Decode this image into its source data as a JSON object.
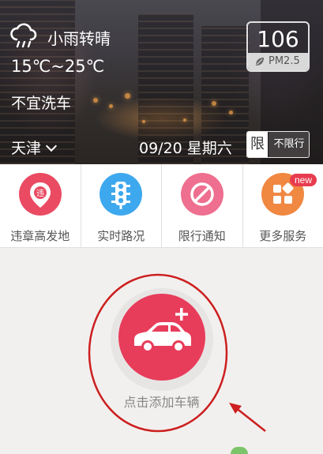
{
  "header": {
    "weather": "小雨转晴",
    "temperature": "15℃~25℃",
    "advice": "不宜洗车",
    "aqi": {
      "value": "106",
      "label": "PM2.5"
    },
    "city": "天津",
    "date": "09/20 星期六",
    "limit_tag": "限",
    "limit_status": "不限行"
  },
  "services": [
    {
      "label": "违章高发地",
      "icon": "violation-location-icon",
      "color": "#ea4b63"
    },
    {
      "label": "实时路况",
      "icon": "traffic-light-icon",
      "color": "#3ea8ee"
    },
    {
      "label": "限行通知",
      "icon": "no-entry-icon",
      "color": "#ee6f8f"
    },
    {
      "label": "更多服务",
      "icon": "grid-icon",
      "color": "#f08842",
      "badge": "new"
    }
  ],
  "add_vehicle": {
    "label": "点击添加车辆",
    "color": "#e83c5b"
  },
  "annotation": {
    "color": "#cc1f1f"
  }
}
